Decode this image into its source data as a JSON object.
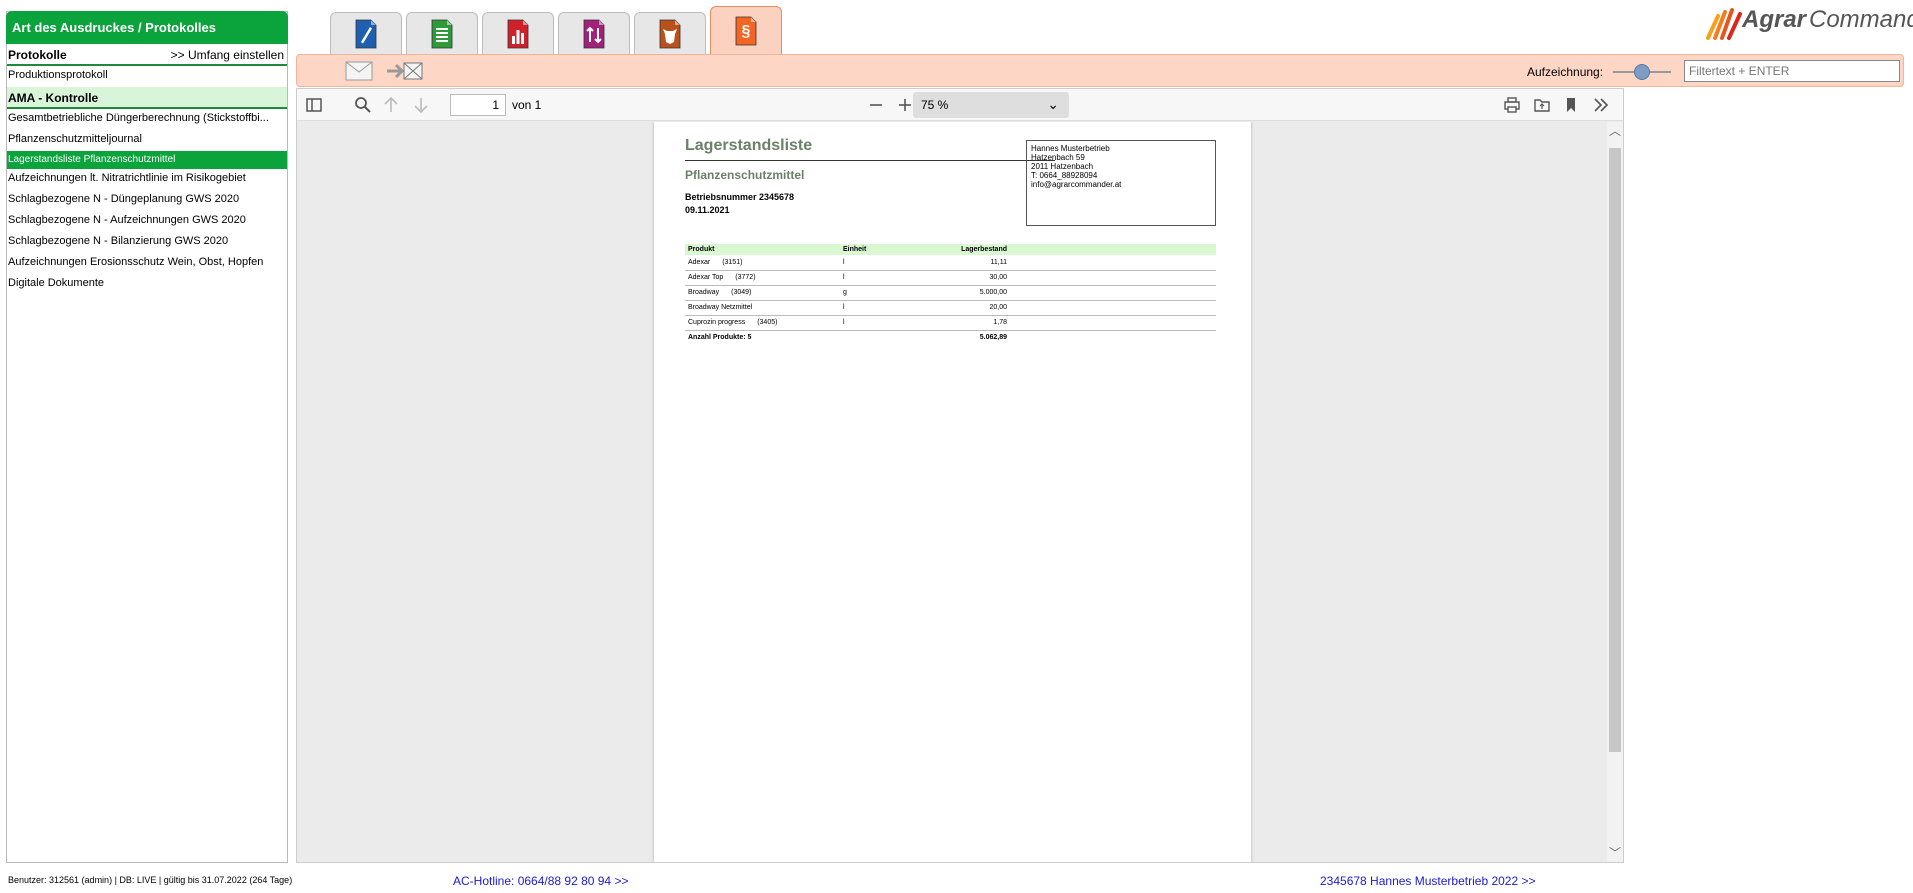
{
  "left_panel": {
    "header": "Art des Ausdruckes / Protokolles",
    "section_protokolle": "Protokolle",
    "umfang_link": ">> Umfang einstellen",
    "item_produktion": "Produktionsprotokoll",
    "section_ama": "AMA - Kontrolle",
    "items": [
      "Gesamtbetriebliche Düngerberechnung (Stickstoffbi...",
      "Pflanzenschutzmitteljournal",
      "Lagerstandsliste Pflanzenschutzmittel",
      "Aufzeichnungen lt. Nitratrichtlinie im Risikogebiet",
      "Schlagbezogene N - Düngeplanung GWS 2020",
      "Schlagbezogene N - Aufzeichnungen GWS 2020",
      "Schlagbezogene N - Bilanzierung GWS 2020",
      "Aufzeichnungen Erosionsschutz Wein, Obst, Hopfen",
      "Digitale Dokumente"
    ],
    "selected_index": 2
  },
  "tabs": [
    {
      "icon": "pencil-doc-icon",
      "color": "#1f5fb0"
    },
    {
      "icon": "list-doc-icon",
      "color": "#2e9a3a"
    },
    {
      "icon": "chart-doc-icon",
      "color": "#d0202a"
    },
    {
      "icon": "transfer-doc-icon",
      "color": "#a0207a"
    },
    {
      "icon": "cow-doc-icon",
      "color": "#b8511a"
    },
    {
      "icon": "paragraph-doc-icon",
      "color": "#f26522",
      "glyph": "§"
    }
  ],
  "logo": {
    "word1": "Agrar",
    "word2": "Commander"
  },
  "toolbar": {
    "recording_label": "Aufzeichnung:",
    "recording_level": 0.5,
    "filter_placeholder": "Filtertext + ENTER"
  },
  "viewer": {
    "page_number": "1",
    "page_of": "von 1",
    "zoom": "75 %"
  },
  "document": {
    "title": "Lagerstandsliste",
    "subtitle": "Pflanzenschutzmittel",
    "betrieb": "Betriebsnummer 2345678",
    "date": "09.11.2021",
    "address": [
      "Hannes Musterbetrieb",
      "Hatzenbach 59",
      "2011 Hatzenbach",
      "T: 0664_88928094",
      "info@agrarcommander.at"
    ],
    "table": {
      "headers": [
        "Produkt",
        "Einheit",
        "Lagerbestand"
      ],
      "rows": [
        {
          "product": "Adexar",
          "code": "(3151)",
          "unit": "l",
          "stock": "11,11"
        },
        {
          "product": "Adexar Top",
          "code": "(3772)",
          "unit": "l",
          "stock": "30,00"
        },
        {
          "product": "Broadway",
          "code": "(3049)",
          "unit": "g",
          "stock": "5.000,00"
        },
        {
          "product": "Broadway Netzmittel",
          "code": "",
          "unit": "l",
          "stock": "20,00"
        },
        {
          "product": "Cuprozin progress",
          "code": "(3405)",
          "unit": "l",
          "stock": "1,78"
        }
      ],
      "total_label": "Anzahl Produkte: 5",
      "total_value": "5.062,89"
    }
  },
  "footer": {
    "user_info": "Benutzer: 312561 (admin) | DB: LIVE | gültig bis 31.07.2022 (264 Tage)",
    "hotline": "AC-Hotline: 0664/88 92 80 94 >>",
    "company": "2345678 Hannes Musterbetrieb 2022 >>"
  }
}
